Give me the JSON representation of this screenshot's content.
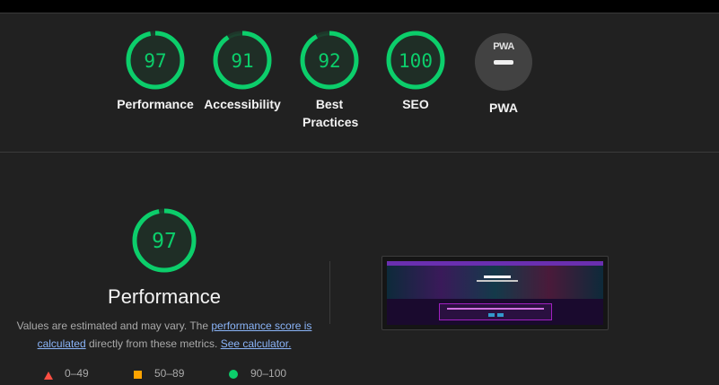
{
  "summary": {
    "gauges": [
      {
        "label": "Performance",
        "score": 97
      },
      {
        "label": "Accessibility",
        "score": 91
      },
      {
        "label": "Best Practices",
        "score": 92
      },
      {
        "label": "SEO",
        "score": 100
      }
    ],
    "pwa": {
      "label": "PWA",
      "badge_text": "PWA"
    }
  },
  "detail": {
    "score": 97,
    "title": "Performance",
    "desc_before": "Values are estimated and may vary. The ",
    "desc_link1": "performance score is calculated",
    "desc_middle": " directly from these metrics. ",
    "desc_link2": "See calculator.",
    "legend": [
      {
        "range": "0–49",
        "color": "#ff4e42",
        "shape": "triangle"
      },
      {
        "range": "50–89",
        "color": "#ffa400",
        "shape": "square"
      },
      {
        "range": "90–100",
        "color": "#0cce6b",
        "shape": "circle"
      }
    ]
  },
  "colors": {
    "pass": "#0cce6b",
    "average": "#ffa400",
    "fail": "#ff4e42",
    "link": "#8ab4f8",
    "background": "#212121"
  }
}
